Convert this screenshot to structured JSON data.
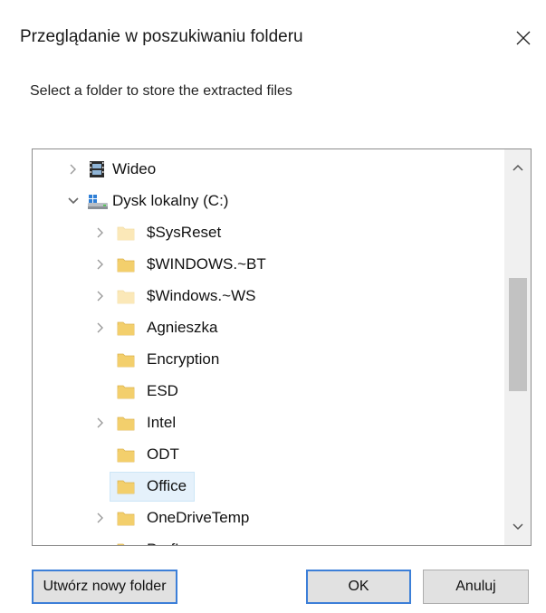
{
  "window": {
    "title": "Przeglądanie w poszukiwaniu folderu",
    "instruction": "Select a folder to store the extracted files"
  },
  "tree": {
    "scroll_position": 0.44,
    "visible_fraction": 0.35,
    "items": [
      {
        "label": "Wideo",
        "level": 0,
        "expander": "collapsed",
        "icon": "video-icon"
      },
      {
        "label": "Dysk lokalny (C:)",
        "level": 0,
        "expander": "expanded",
        "icon": "drive-icon"
      },
      {
        "label": "$SysReset",
        "level": 1,
        "expander": "collapsed",
        "icon": "folder-hidden-icon"
      },
      {
        "label": "$WINDOWS.~BT",
        "level": 1,
        "expander": "collapsed",
        "icon": "folder-icon"
      },
      {
        "label": "$Windows.~WS",
        "level": 1,
        "expander": "collapsed",
        "icon": "folder-hidden-icon"
      },
      {
        "label": "Agnieszka",
        "level": 1,
        "expander": "collapsed",
        "icon": "folder-icon"
      },
      {
        "label": "Encryption",
        "level": 1,
        "expander": "none",
        "icon": "folder-icon"
      },
      {
        "label": "ESD",
        "level": 1,
        "expander": "none",
        "icon": "folder-icon"
      },
      {
        "label": "Intel",
        "level": 1,
        "expander": "collapsed",
        "icon": "folder-icon"
      },
      {
        "label": "ODT",
        "level": 1,
        "expander": "none",
        "icon": "folder-icon"
      },
      {
        "label": "Office",
        "level": 1,
        "expander": "none",
        "icon": "folder-icon",
        "selected": true
      },
      {
        "label": "OneDriveTemp",
        "level": 1,
        "expander": "collapsed",
        "icon": "folder-icon"
      },
      {
        "label": "PerfLogs",
        "level": 1,
        "expander": "none",
        "icon": "folder-icon"
      }
    ]
  },
  "buttons": {
    "new_folder": "Utwórz nowy folder",
    "ok": "OK",
    "cancel": "Anuluj"
  },
  "colors": {
    "folder": "#f3cf6c",
    "folder_hidden": "#fbe8b8",
    "selection": "#e5f1fb",
    "default_button_border": "#3c7fd8"
  }
}
